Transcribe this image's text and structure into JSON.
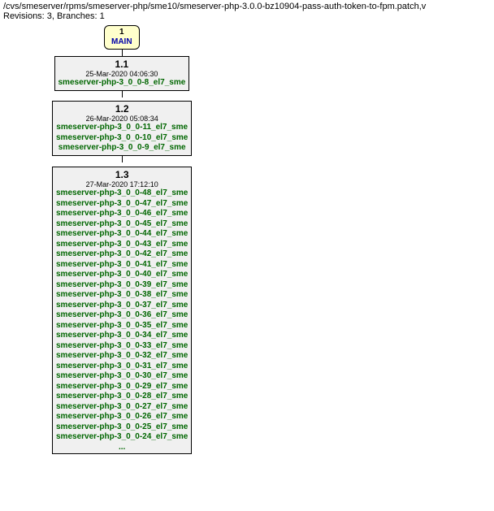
{
  "header": {
    "path": "/cvs/smeserver/rpms/smeserver-php/sme10/smeserver-php-3.0.0-bz10904-pass-auth-token-to-fpm.patch,v",
    "stats": "Revisions: 3, Branches: 1"
  },
  "branch": {
    "number": "1",
    "name": "MAIN"
  },
  "revisions": [
    {
      "num": "1.1",
      "date": "25-Mar-2020 04:06:30",
      "tags": [
        "smeserver-php-3_0_0-8_el7_sme"
      ],
      "truncated": false
    },
    {
      "num": "1.2",
      "date": "26-Mar-2020 05:08:34",
      "tags": [
        "smeserver-php-3_0_0-11_el7_sme",
        "smeserver-php-3_0_0-10_el7_sme",
        "smeserver-php-3_0_0-9_el7_sme"
      ],
      "truncated": false
    },
    {
      "num": "1.3",
      "date": "27-Mar-2020 17:12:10",
      "tags": [
        "smeserver-php-3_0_0-48_el7_sme",
        "smeserver-php-3_0_0-47_el7_sme",
        "smeserver-php-3_0_0-46_el7_sme",
        "smeserver-php-3_0_0-45_el7_sme",
        "smeserver-php-3_0_0-44_el7_sme",
        "smeserver-php-3_0_0-43_el7_sme",
        "smeserver-php-3_0_0-42_el7_sme",
        "smeserver-php-3_0_0-41_el7_sme",
        "smeserver-php-3_0_0-40_el7_sme",
        "smeserver-php-3_0_0-39_el7_sme",
        "smeserver-php-3_0_0-38_el7_sme",
        "smeserver-php-3_0_0-37_el7_sme",
        "smeserver-php-3_0_0-36_el7_sme",
        "smeserver-php-3_0_0-35_el7_sme",
        "smeserver-php-3_0_0-34_el7_sme",
        "smeserver-php-3_0_0-33_el7_sme",
        "smeserver-php-3_0_0-32_el7_sme",
        "smeserver-php-3_0_0-31_el7_sme",
        "smeserver-php-3_0_0-30_el7_sme",
        "smeserver-php-3_0_0-29_el7_sme",
        "smeserver-php-3_0_0-28_el7_sme",
        "smeserver-php-3_0_0-27_el7_sme",
        "smeserver-php-3_0_0-26_el7_sme",
        "smeserver-php-3_0_0-25_el7_sme",
        "smeserver-php-3_0_0-24_el7_sme"
      ],
      "truncated": true
    }
  ],
  "ellipsis": "..."
}
